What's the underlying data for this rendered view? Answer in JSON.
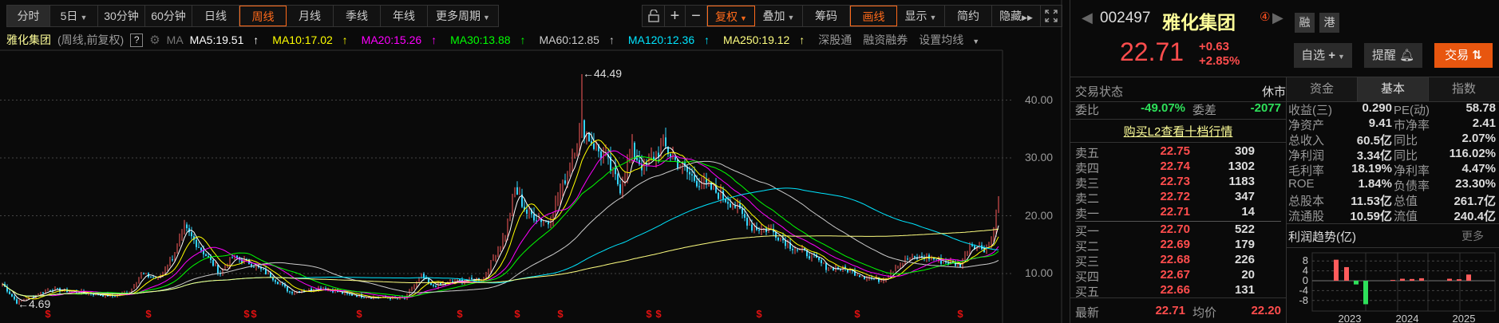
{
  "toolbar_left": [
    {
      "label": "分时",
      "active": false
    },
    {
      "label": "5日",
      "caret": true
    },
    {
      "label": "30分钟"
    },
    {
      "label": "60分钟"
    },
    {
      "label": "日线"
    },
    {
      "label": "周线",
      "active": true
    },
    {
      "label": "月线"
    },
    {
      "label": "季线"
    },
    {
      "label": "年线"
    },
    {
      "label": "更多周期",
      "caret": true
    }
  ],
  "toolbar_right": {
    "lock": "lock-icon",
    "zoom_in": "+",
    "zoom_out": "−",
    "adjust": "复权",
    "overlay": "叠加",
    "chips": "筹码",
    "draw": "画线",
    "display": "显示",
    "simple": "简约",
    "hide": "隐藏",
    "hide_arrow": "▶▶",
    "expand": "expand-icon"
  },
  "ma_bar": {
    "stock": "雅化集团",
    "mode": "(周线,前复权)",
    "help": "?",
    "ma": "MA",
    "items": [
      {
        "label": "MA5:19.51",
        "color": "#ffffff"
      },
      {
        "label": "MA10:17.02",
        "color": "#ffff00"
      },
      {
        "label": "MA20:15.26",
        "color": "#ff00ff"
      },
      {
        "label": "MA30:13.88",
        "color": "#00ff00"
      },
      {
        "label": "MA60:12.85",
        "color": "#cccccc"
      },
      {
        "label": "MA120:12.36",
        "color": "#00e5ff"
      },
      {
        "label": "MA250:19.12",
        "color": "#ffff80"
      }
    ],
    "arrow": "↑",
    "links": [
      "深股通",
      "融资融券",
      "设置均线"
    ]
  },
  "chart_data": {
    "type": "candlestick",
    "period": "weekly",
    "y_ticks": [
      "40.00",
      "30.00",
      "20.00",
      "10.00"
    ],
    "ylim": [
      4,
      46
    ],
    "max_label": "44.49",
    "min_label": "4.69",
    "max_week": 242,
    "min_week": 6,
    "price_path": [
      [
        0,
        8.2
      ],
      [
        6,
        5.0
      ],
      [
        20,
        7.3
      ],
      [
        46,
        6.1
      ],
      [
        53,
        6.8
      ],
      [
        58,
        9.9
      ],
      [
        65,
        9.1
      ],
      [
        71,
        12.8
      ],
      [
        76,
        17.8
      ],
      [
        83,
        14.2
      ],
      [
        91,
        10.0
      ],
      [
        96,
        12.8
      ],
      [
        103,
        11.9
      ],
      [
        112,
        9.6
      ],
      [
        120,
        6.8
      ],
      [
        134,
        7.5
      ],
      [
        144,
        6.4
      ],
      [
        154,
        5.9
      ],
      [
        168,
        5.7
      ],
      [
        175,
        9.6
      ],
      [
        179,
        7.8
      ],
      [
        190,
        8.7
      ],
      [
        201,
        9.1
      ],
      [
        210,
        16.9
      ],
      [
        214,
        24.7
      ],
      [
        219,
        20.5
      ],
      [
        228,
        18.8
      ],
      [
        234,
        25.2
      ],
      [
        242,
        35.4
      ],
      [
        248,
        31.7
      ],
      [
        253,
        29.0
      ],
      [
        258,
        24.8
      ],
      [
        263,
        31.3
      ],
      [
        268,
        28.1
      ],
      [
        276,
        32.2
      ],
      [
        281,
        29.5
      ],
      [
        289,
        26.3
      ],
      [
        297,
        24.4
      ],
      [
        306,
        21.7
      ],
      [
        313,
        18.0
      ],
      [
        321,
        17.5
      ],
      [
        329,
        14.8
      ],
      [
        338,
        13.0
      ],
      [
        344,
        11.1
      ],
      [
        352,
        10.7
      ],
      [
        361,
        9.3
      ],
      [
        367,
        8.8
      ],
      [
        373,
        11.1
      ],
      [
        378,
        12.5
      ],
      [
        386,
        12.9
      ],
      [
        393,
        12.0
      ],
      [
        400,
        11.5
      ],
      [
        404,
        15.2
      ],
      [
        410,
        14.3
      ],
      [
        413,
        15.6
      ],
      [
        416,
        22.71
      ]
    ],
    "ma_periods": [
      5,
      10,
      20,
      30,
      60,
      120,
      250
    ],
    "dividend_marker": "$",
    "dividend_marker_weeks": [
      19,
      61,
      102,
      105,
      149,
      191,
      215,
      233,
      270,
      274,
      316,
      357,
      400
    ],
    "colors": {
      "up": "#ff5c5c",
      "down": "#33d6ff"
    }
  },
  "quote": {
    "code": "002497",
    "name": "雅化集团",
    "badge_num": "④",
    "tags": [
      "融",
      "港"
    ],
    "price": "22.71",
    "change": "+0.63",
    "change_pct": "+2.85%",
    "watch_btn": "自选",
    "watch_plus": "+",
    "alert_btn": "提醒",
    "trade_btn": "交易",
    "trade_icon": "⇅"
  },
  "status": {
    "label": "交易状态",
    "value": "休市"
  },
  "tabs": [
    {
      "label": "资金"
    },
    {
      "label": "基本",
      "active": true
    },
    {
      "label": "指数"
    }
  ],
  "order_book": {
    "wb_label": "委比",
    "wb_value": "-49.07%",
    "wc_label": "委差",
    "wc_value": "-2077",
    "l2_link": "购买L2查看十档行情",
    "asks": [
      [
        "卖五",
        "22.75",
        "309"
      ],
      [
        "卖四",
        "22.74",
        "1302"
      ],
      [
        "卖三",
        "22.73",
        "1183"
      ],
      [
        "卖二",
        "22.72",
        "347"
      ],
      [
        "卖一",
        "22.71",
        "14"
      ]
    ],
    "bids": [
      [
        "买一",
        "22.70",
        "522"
      ],
      [
        "买二",
        "22.69",
        "179"
      ],
      [
        "买三",
        "22.68",
        "226"
      ],
      [
        "买四",
        "22.67",
        "20"
      ],
      [
        "买五",
        "22.66",
        "131"
      ]
    ],
    "last_label": "最新",
    "last_value": "22.71",
    "avg_label": "均价",
    "avg_value": "22.20"
  },
  "fundamentals": [
    [
      "收益(三)",
      "0.290",
      "PE(动)",
      "58.78"
    ],
    [
      "净资产",
      "9.41",
      "市净率",
      "2.41"
    ],
    [
      "总收入",
      "60.5亿",
      "同比",
      "2.07%"
    ],
    [
      "净利润",
      "3.34亿",
      "同比",
      "116.02%"
    ],
    [
      "毛利率",
      "18.19%",
      "净利率",
      "4.47%"
    ],
    [
      "ROE",
      "1.84%",
      "负债率",
      "23.30%"
    ],
    [
      "总股本",
      "11.53亿",
      "总值",
      "261.7亿"
    ],
    [
      "流通股",
      "10.59亿",
      "流值",
      "240.4亿"
    ]
  ],
  "profit": {
    "title": "利润趋势(亿)",
    "more": "更多",
    "y_ticks": [
      "8",
      "4",
      "0",
      "-4",
      "-8"
    ],
    "years": [
      "2023",
      "2024",
      "2025"
    ],
    "bars": [
      [
        "2023Q1",
        8.5
      ],
      [
        "2023Q2",
        5.5
      ],
      [
        "2023Q3",
        -1.5
      ],
      [
        "2023Q4",
        -9.5
      ],
      [
        "2024Q1",
        0.3
      ],
      [
        "2024Q2",
        0.8
      ],
      [
        "2024Q3",
        0.7
      ],
      [
        "2024Q4",
        1.0
      ],
      [
        "2025Q1",
        0.8
      ],
      [
        "2025Q2",
        0.6
      ],
      [
        "2025Q3",
        2.5
      ]
    ]
  }
}
